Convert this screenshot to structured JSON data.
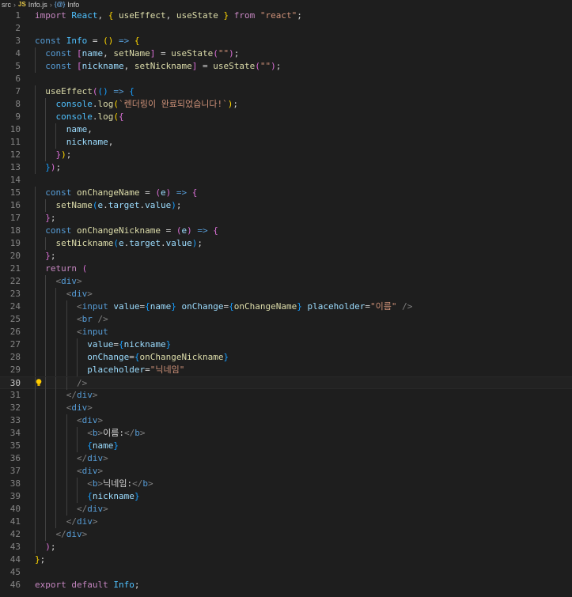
{
  "breadcrumb": {
    "folder": "src",
    "file_icon": "JS",
    "file": "Info.js",
    "symbol_icon": "{@}",
    "symbol": "Info"
  },
  "editor": {
    "current_line": 30,
    "lines": [
      "import React, { useEffect, useState } from \"react\";",
      "",
      "const Info = () => {",
      "  const [name, setName] = useState(\"\");",
      "  const [nickname, setNickname] = useState(\"\");",
      "",
      "  useEffect(() => {",
      "    console.log(`렌더링이 완료되었습니다!`);",
      "    console.log({",
      "      name,",
      "      nickname,",
      "    });",
      "  });",
      "",
      "  const onChangeName = (e) => {",
      "    setName(e.target.value);",
      "  };",
      "  const onChangeNickname = (e) => {",
      "    setNickname(e.target.value);",
      "  };",
      "  return (",
      "    <div>",
      "      <div>",
      "        <input value={name} onChange={onChangeName} placeholder=\"이름\" />",
      "        <br />",
      "        <input",
      "          value={nickname}",
      "          onChange={onChangeNickname}",
      "          placeholder=\"닉네임\"",
      "        />",
      "      </div>",
      "      <div>",
      "        <div>",
      "          <b>이름:</b>",
      "          {name}",
      "        </div>",
      "        <div>",
      "          <b>닉네임:</b>",
      "          {nickname}",
      "        </div>",
      "      </div>",
      "    </div>",
      "  );",
      "};",
      "",
      "export default Info;"
    ]
  },
  "colors": {
    "background": "#1e1e1e",
    "keyword": "#c586c0",
    "storage": "#569cd6",
    "variable": "#9cdcfe",
    "function": "#dcdcaa",
    "string": "#ce9178",
    "line_number": "#858585"
  },
  "icons": {
    "breadcrumb_separator": "chevron-right-icon",
    "file_type": "javascript-icon",
    "symbol_type": "symbol-variable-icon",
    "lightbulb": "lightbulb-icon"
  }
}
